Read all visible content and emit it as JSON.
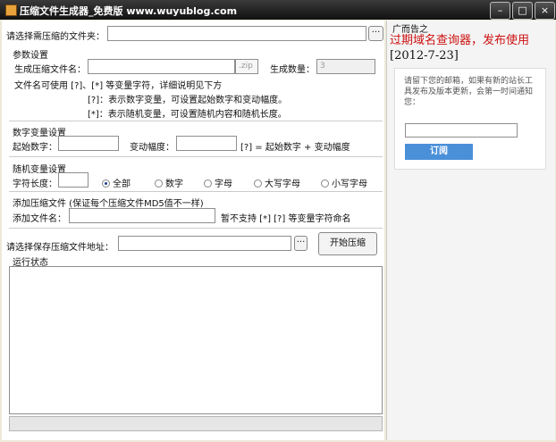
{
  "title": "压缩文件生成器_免费版 www.wuyublog.com",
  "window_controls": {
    "minimize": "–",
    "maximize": "□",
    "close": "×"
  },
  "folder": {
    "label": "请选择需压缩的文件夹：",
    "value": "",
    "browse": "···"
  },
  "params": {
    "header": "参数设置",
    "name_label": "生成压缩文件名：",
    "name_value": "",
    "ext": ".zip",
    "count_label": "生成数量：",
    "count_value": "3",
    "note1": "文件名可使用 [?]、[*] 等变量字符，详细说明见下方",
    "note2": "[?]：表示数字变量，可设置起始数字和变动幅度。",
    "note3": "[*]：表示随机变量，可设置随机内容和随机长度。"
  },
  "number_var": {
    "header": "数字变量设置",
    "start_label": "起始数字：",
    "start_value": "",
    "step_label": "变动幅度：",
    "step_value": "",
    "formula": "[?] = 起始数字 + 变动幅度"
  },
  "random_var": {
    "header": "随机变量设置",
    "length_label": "字符长度：",
    "length_value": "",
    "options": [
      "全部",
      "数字",
      "字母",
      "大写字母",
      "小写字母"
    ],
    "selected": "全部"
  },
  "add_file": {
    "header": "添加压缩文件 (保证每个压缩文件MD5值不一样)",
    "name_label": "添加文件名：",
    "name_value": "",
    "note": "暂不支持 [*] [?] 等变量字符命名"
  },
  "save": {
    "label": "请选择保存压缩文件地址：",
    "value": "",
    "browse": "···",
    "start_button": "开始压缩"
  },
  "status": {
    "header": "运行状态",
    "log": "",
    "progress_pct": 0
  },
  "ad": {
    "title": "广而告之",
    "link_text": "过期域名查询器，发布使用",
    "date": "[2012-7-23]",
    "notice": "请留下您的邮箱，如果有新的站长工具发布及版本更新，会第一时间通知您：",
    "email_value": "",
    "subscribe": "订阅"
  },
  "colors": {
    "titlebar": "#1a1a1a",
    "ad_link": "#cc1111",
    "subscribe_btn": "#4a90d9"
  }
}
